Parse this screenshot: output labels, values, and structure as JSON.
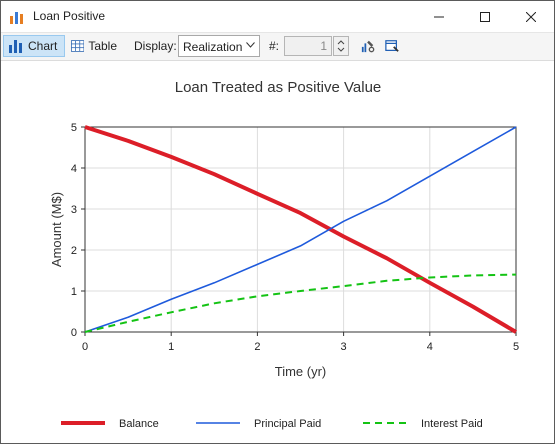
{
  "window": {
    "title": "Loan Positive"
  },
  "toolbar": {
    "chart_label": "Chart",
    "table_label": "Table",
    "display_label": "Display:",
    "display_value": "Realization",
    "number_label": "#:",
    "number_value": "1"
  },
  "chart_data": {
    "type": "line",
    "title": "Loan Treated as Positive Value",
    "xlabel": "Time (yr)",
    "ylabel": "Amount (M$)",
    "xlim": [
      0,
      5
    ],
    "ylim": [
      0,
      5
    ],
    "xticks": [
      "0",
      "1",
      "2",
      "3",
      "4",
      "5"
    ],
    "yticks": [
      "0",
      "1",
      "2",
      "3",
      "4",
      "5"
    ],
    "grid": true,
    "legend_position": "bottom",
    "series": [
      {
        "name": "Balance",
        "color": "#dc1e28",
        "style": "solid-thick",
        "x": [
          0,
          0.5,
          1,
          1.5,
          2,
          2.5,
          3,
          3.5,
          4,
          4.5,
          5
        ],
        "y": [
          5.0,
          4.66,
          4.27,
          3.85,
          3.37,
          2.9,
          2.33,
          1.8,
          1.2,
          0.62,
          0
        ]
      },
      {
        "name": "Principal Paid",
        "color": "#1e5adc",
        "style": "solid",
        "x": [
          0,
          0.5,
          1,
          1.5,
          2,
          2.5,
          3,
          3.5,
          4,
          4.5,
          5
        ],
        "y": [
          0,
          0.36,
          0.8,
          1.2,
          1.65,
          2.1,
          2.7,
          3.2,
          3.8,
          4.4,
          5.0
        ]
      },
      {
        "name": "Interest Paid",
        "color": "#14c314",
        "style": "dashed",
        "x": [
          0,
          0.5,
          1,
          1.5,
          2,
          2.5,
          3,
          3.5,
          4,
          4.5,
          5
        ],
        "y": [
          0,
          0.25,
          0.48,
          0.7,
          0.87,
          1.0,
          1.12,
          1.25,
          1.33,
          1.38,
          1.4
        ]
      }
    ]
  }
}
